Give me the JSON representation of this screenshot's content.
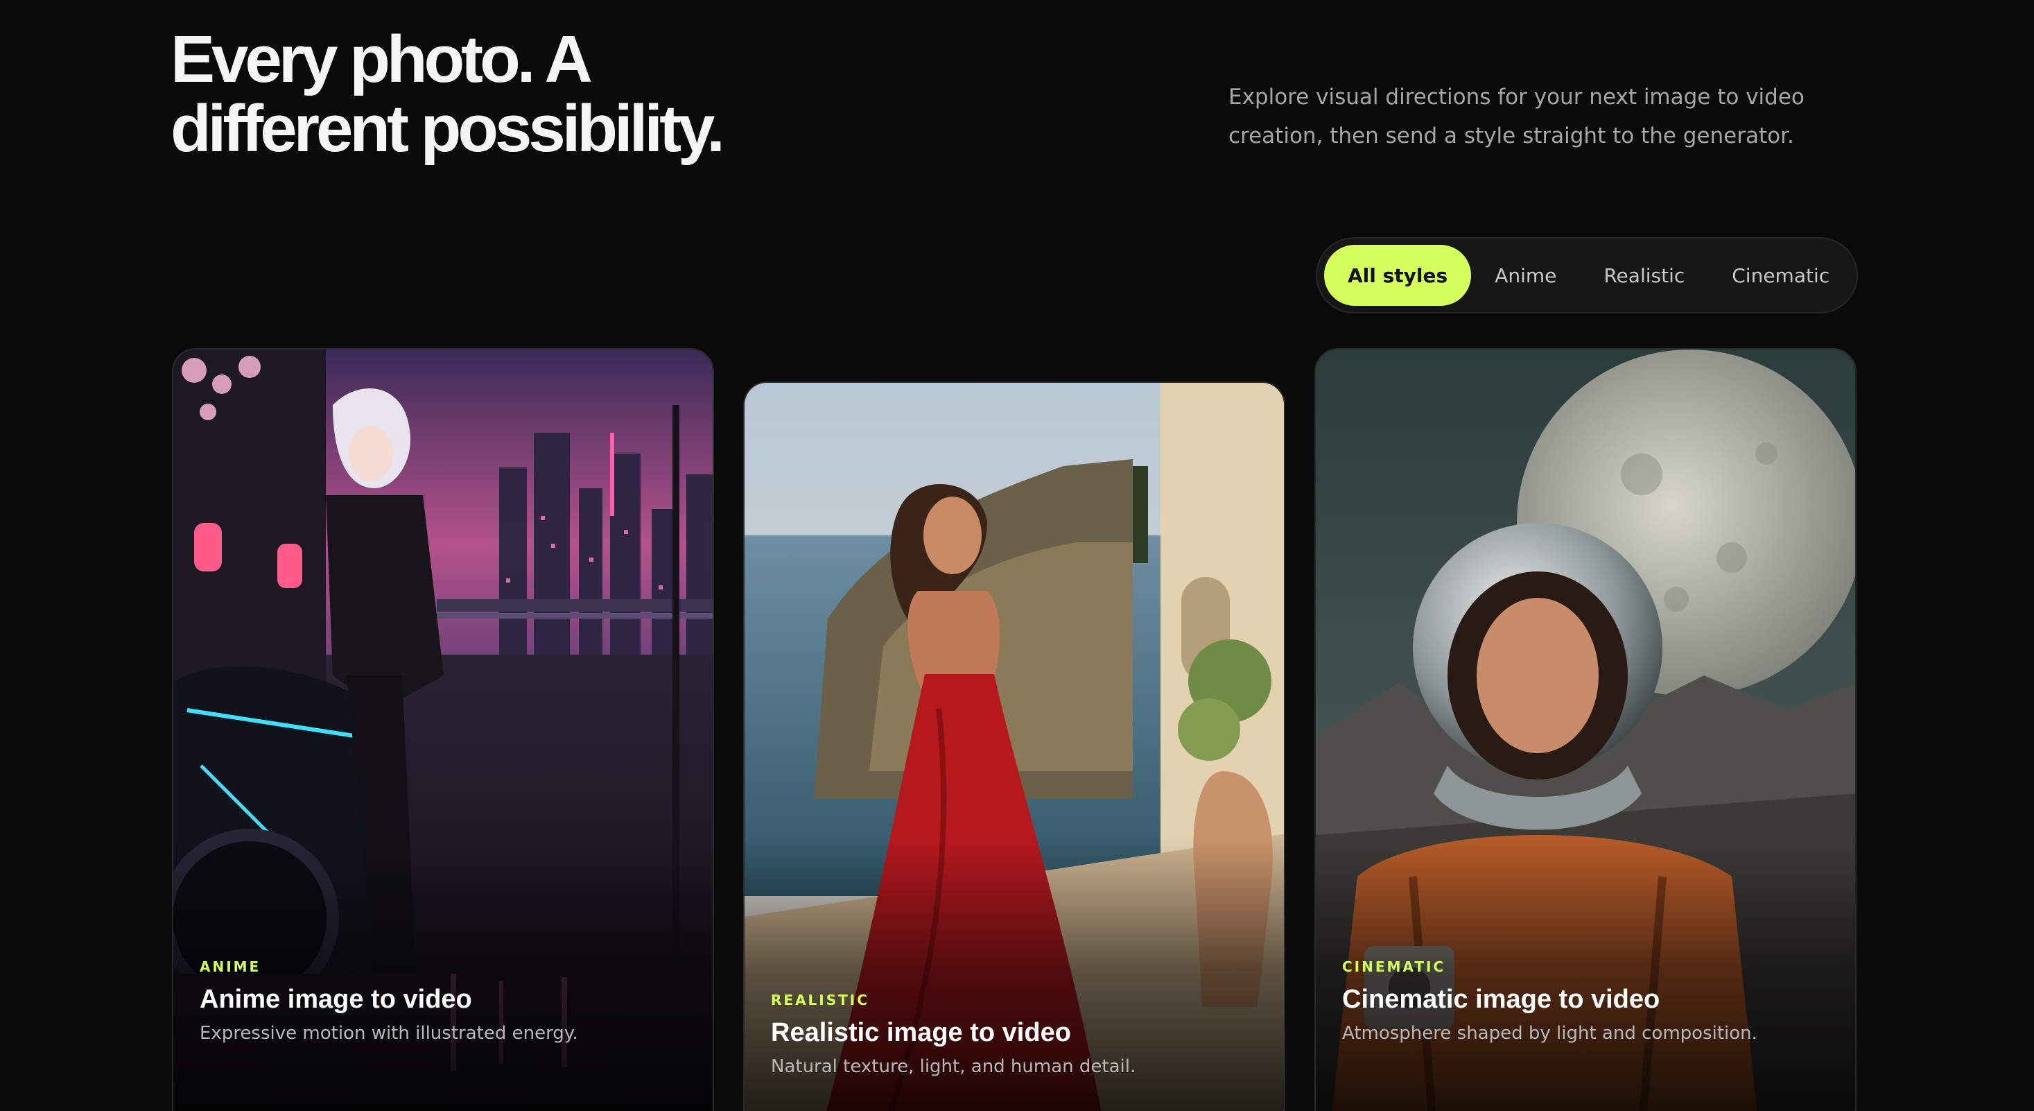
{
  "header": {
    "title_line1": "Every photo. A",
    "title_line2": "different possibility.",
    "intro": "Explore visual directions for your next image to video creation, then send a style straight to the generator."
  },
  "filters": {
    "items": [
      {
        "label": "All styles",
        "active": true
      },
      {
        "label": "Anime",
        "active": false
      },
      {
        "label": "Realistic",
        "active": false
      },
      {
        "label": "Cinematic",
        "active": false
      }
    ]
  },
  "cards": [
    {
      "tag": "ANIME",
      "title": "Anime image to video",
      "description": "Expressive motion with illustrated energy."
    },
    {
      "tag": "REALISTIC",
      "title": "Realistic image to video",
      "description": "Natural texture, light, and human detail."
    },
    {
      "tag": "CINEMATIC",
      "title": "Cinematic image to video",
      "description": "Atmosphere shaped by light and composition."
    }
  ],
  "colors": {
    "accent": "#d4ff5c",
    "background": "#0a0a0a"
  }
}
